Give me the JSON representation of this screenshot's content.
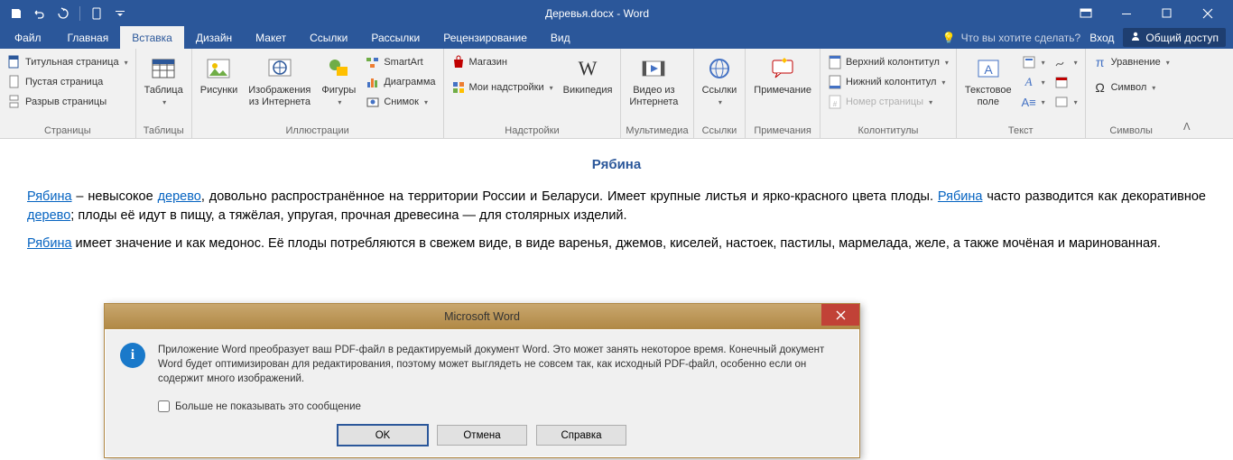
{
  "title": "Деревья.docx - Word",
  "tabs": {
    "file": "Файл",
    "home": "Главная",
    "insert": "Вставка",
    "design": "Дизайн",
    "layout": "Макет",
    "references": "Ссылки",
    "mailings": "Рассылки",
    "review": "Рецензирование",
    "view": "Вид"
  },
  "tellme": "Что вы хотите сделать?",
  "login": "Вход",
  "share": "Общий доступ",
  "ribbon": {
    "pages": {
      "label": "Страницы",
      "cover": "Титульная страница",
      "blank": "Пустая страница",
      "break": "Разрыв страницы"
    },
    "tables": {
      "label": "Таблицы",
      "table": "Таблица"
    },
    "illus": {
      "label": "Иллюстрации",
      "pictures": "Рисунки",
      "online": "Изображения\nиз Интернета",
      "shapes": "Фигуры",
      "smartart": "SmartArt",
      "chart": "Диаграмма",
      "screenshot": "Снимок"
    },
    "addins": {
      "label": "Надстройки",
      "store": "Магазин",
      "myaddins": "Мои надстройки",
      "wiki": "Википедия"
    },
    "media": {
      "label": "Мультимедиа",
      "video": "Видео из\nИнтернета"
    },
    "links": {
      "label": "Ссылки",
      "btn": "Ссылки"
    },
    "comments": {
      "label": "Примечания",
      "btn": "Примечание"
    },
    "headers": {
      "label": "Колонтитулы",
      "header": "Верхний колонтитул",
      "footer": "Нижний колонтитул",
      "pagenum": "Номер страницы"
    },
    "text": {
      "label": "Текст",
      "textbox": "Текстовое\nполе"
    },
    "symbols": {
      "label": "Символы",
      "equation": "Уравнение",
      "symbol": "Символ"
    }
  },
  "doc": {
    "title": "Рябина",
    "link1": "Рябина",
    "p1a": " – невысокое ",
    "link2": "дерево",
    "p1b": ", довольно распространённое на территории России и Беларуси. Имеет крупные листья и ярко-красного цвета плоды. ",
    "link3": "Рябина",
    "p1c": " часто разводится как декоративное ",
    "link4": "дерево",
    "p1d": "; плоды её идут в пищу, а тяжёлая, упругая, прочная древесина — для столярных изделий.",
    "link5": "Рябина",
    "p2": " имеет значение и как медонос. Её плоды потребляются в свежем виде, в виде варенья, джемов, киселей, настоек, пастилы, мармелада, желе, а также мочёная и маринованная."
  },
  "dlg": {
    "title": "Microsoft Word",
    "msg": "Приложение Word преобразует ваш PDF-файл в редактируемый документ Word. Это может занять некоторое время. Конечный документ Word будет оптимизирован для редактирования, поэтому может выглядеть не совсем так, как исходный PDF-файл, особенно если он содержит много изображений.",
    "chk": "Больше не показывать это сообщение",
    "ok": "OK",
    "cancel": "Отмена",
    "help": "Справка"
  }
}
